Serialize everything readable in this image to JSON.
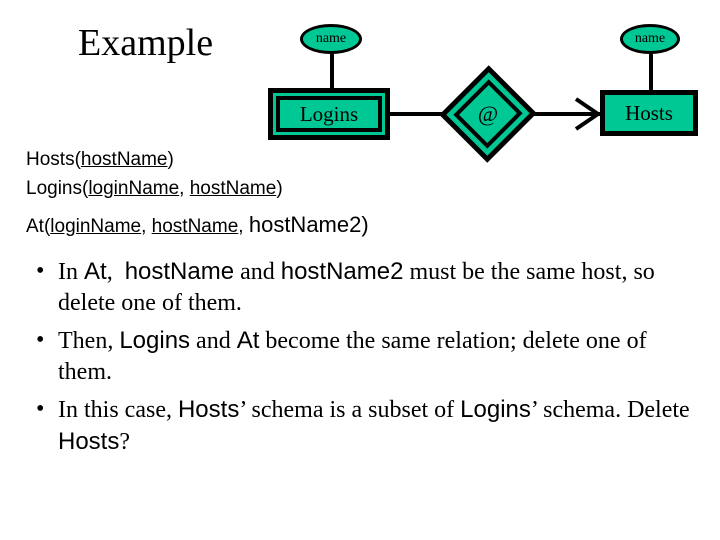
{
  "slide": {
    "title": "Example",
    "background_color": "#ffffff",
    "entity_fill_color": "#00c895",
    "line_color": "#000000"
  },
  "diagram": {
    "type": "entity-relationship",
    "attributes": [
      {
        "id": "logins-name",
        "label": "name",
        "attached_to": "Logins"
      },
      {
        "id": "hosts-name",
        "label": "name",
        "attached_to": "Hosts"
      }
    ],
    "entities": [
      {
        "id": "logins",
        "label": "Logins",
        "border": "double"
      },
      {
        "id": "hosts",
        "label": "Hosts",
        "border": "single"
      }
    ],
    "relationships": [
      {
        "id": "at",
        "label": "@",
        "shape": "diamond",
        "border": "double"
      }
    ],
    "edges": [
      {
        "from": "Logins",
        "to": "@",
        "arrow": "none"
      },
      {
        "from": "@",
        "to": "Hosts",
        "arrow": "pointed"
      },
      {
        "from": "name",
        "to": "Logins",
        "arrow": "none"
      },
      {
        "from": "name",
        "to": "Hosts",
        "arrow": "none"
      }
    ]
  },
  "schemas": [
    {
      "id": "hosts-schema",
      "parts": [
        {
          "text": "Hosts(",
          "underline": false,
          "size": "normal"
        },
        {
          "text": "hostName",
          "underline": true,
          "size": "normal"
        },
        {
          "text": ")",
          "underline": false,
          "size": "normal"
        }
      ]
    },
    {
      "id": "logins-schema",
      "parts": [
        {
          "text": "Logins(",
          "underline": false,
          "size": "normal"
        },
        {
          "text": "loginName",
          "underline": true,
          "size": "normal"
        },
        {
          "text": ", ",
          "underline": false,
          "size": "normal"
        },
        {
          "text": "hostName",
          "underline": true,
          "size": "normal"
        },
        {
          "text": ")",
          "underline": false,
          "size": "normal"
        }
      ]
    },
    {
      "id": "at-schema",
      "parts": [
        {
          "text": "At(",
          "underline": false,
          "size": "normal"
        },
        {
          "text": "loginName",
          "underline": true,
          "size": "normal"
        },
        {
          "text": ", ",
          "underline": false,
          "size": "normal"
        },
        {
          "text": "hostName",
          "underline": true,
          "size": "normal"
        },
        {
          "text": ", ",
          "underline": false,
          "size": "normal"
        },
        {
          "text": "hostName2",
          "underline": false,
          "size": "big"
        },
        {
          "text": ")",
          "underline": false,
          "size": "big"
        }
      ]
    }
  ],
  "bullets": [
    {
      "id": "bullet-1",
      "marker": "•",
      "parts": [
        {
          "text": "In ",
          "font": "serif"
        },
        {
          "text": "At",
          "font": "sans"
        },
        {
          "text": ",  ",
          "font": "serif"
        },
        {
          "text": "hostName",
          "font": "sans"
        },
        {
          "text": " and ",
          "font": "serif"
        },
        {
          "text": "hostName2",
          "font": "sans"
        },
        {
          "text": " must be the same host, so delete one of them.",
          "font": "serif"
        }
      ]
    },
    {
      "id": "bullet-2",
      "marker": "•",
      "parts": [
        {
          "text": "Then, ",
          "font": "serif"
        },
        {
          "text": "Logins",
          "font": "sans"
        },
        {
          "text": " and ",
          "font": "serif"
        },
        {
          "text": "At",
          "font": "sans"
        },
        {
          "text": " become the same relation; delete one of them.",
          "font": "serif"
        }
      ]
    },
    {
      "id": "bullet-3",
      "marker": "•",
      "parts": [
        {
          "text": "In this case, ",
          "font": "serif"
        },
        {
          "text": "Hosts",
          "font": "sans"
        },
        {
          "text": "’ schema is a subset of ",
          "font": "serif"
        },
        {
          "text": "Logins",
          "font": "sans"
        },
        {
          "text": "’ schema. Delete ",
          "font": "serif"
        },
        {
          "text": "Hosts",
          "font": "sans"
        },
        {
          "text": "?",
          "font": "serif"
        }
      ]
    }
  ]
}
